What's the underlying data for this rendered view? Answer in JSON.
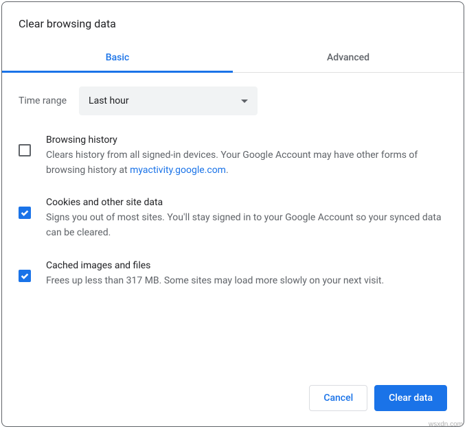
{
  "dialog": {
    "title": "Clear browsing data"
  },
  "tabs": {
    "basic": "Basic",
    "advanced": "Advanced"
  },
  "time_range": {
    "label": "Time range",
    "value": "Last hour"
  },
  "options": {
    "browsing_history": {
      "checked": false,
      "title": "Browsing history",
      "desc_pre": "Clears history from all signed-in devices. Your Google Account may have other forms of browsing history at ",
      "link_text": "myactivity.google.com",
      "desc_post": "."
    },
    "cookies": {
      "checked": true,
      "title": "Cookies and other site data",
      "desc": "Signs you out of most sites. You'll stay signed in to your Google Account so your synced data can be cleared."
    },
    "cache": {
      "checked": true,
      "title": "Cached images and files",
      "desc": "Frees up less than 317 MB. Some sites may load more slowly on your next visit."
    }
  },
  "buttons": {
    "cancel": "Cancel",
    "clear": "Clear data"
  },
  "watermark": "wsxdn.com"
}
